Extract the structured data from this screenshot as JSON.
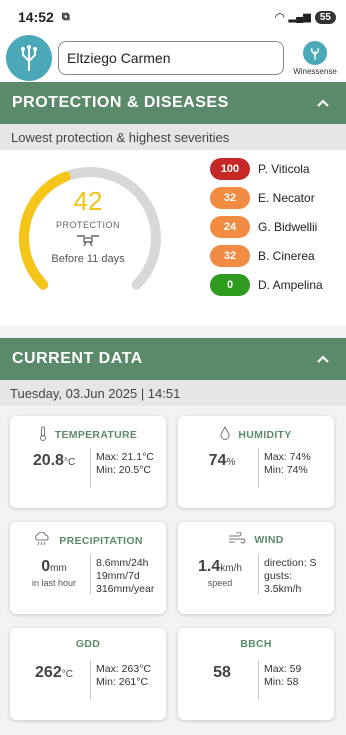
{
  "status": {
    "time": "14:52",
    "battery": "55"
  },
  "header": {
    "search_value": "Eltziego Carmen",
    "brand": "Winessense"
  },
  "protection": {
    "section_title": "PROTECTION & DISEASES",
    "subtitle": "Lowest protection & highest severities",
    "value": "42",
    "label": "PROTECTION",
    "before": "Before 11 days",
    "gauge_fraction": 0.42,
    "diseases": [
      {
        "score": "100",
        "name": "P. Viticola",
        "color": "#c62828"
      },
      {
        "score": "32",
        "name": "E. Necator",
        "color": "#f28c42"
      },
      {
        "score": "24",
        "name": "G. Bidwellii",
        "color": "#f28c42"
      },
      {
        "score": "32",
        "name": "B. Cinerea",
        "color": "#f28c42"
      },
      {
        "score": "0",
        "name": "D. Ampelina",
        "color": "#2e9a1e"
      }
    ]
  },
  "current": {
    "section_title": "CURRENT DATA",
    "date": "Tuesday, 03.Jun 2025 | 14:51",
    "temperature": {
      "title": "TEMPERATURE",
      "value": "20.8",
      "unit": "°C",
      "max": "Max: 21.1°C",
      "min": "Min: 20.5°C"
    },
    "humidity": {
      "title": "HUMIDITY",
      "value": "74",
      "unit": "%",
      "max": "Max: 74%",
      "min": "Min: 74%"
    },
    "precipitation": {
      "title": "PRECIPITATION",
      "value": "0",
      "unit": "mm",
      "sub": "in last hour",
      "line1": "8.6mm/24h",
      "line2": "19mm/7d",
      "line3": "316mm/year"
    },
    "wind": {
      "title": "WIND",
      "value": "1.4",
      "unit": "km/h",
      "sub": "speed",
      "line1": "direction: S",
      "line2": "gusts:",
      "line3": "3.5km/h"
    },
    "gdd": {
      "title": "GDD",
      "value": "262",
      "unit": "°C",
      "max": "Max: 263°C",
      "min": "Min: 261°C"
    },
    "bbch": {
      "title": "BBCH",
      "value": "58",
      "max": "Max: 59",
      "min": "Min: 58"
    }
  },
  "colors": {
    "accent_green": "#5b8a6b",
    "gauge_yellow": "#f5c518",
    "gauge_track": "#d8d8d8",
    "logo_teal": "#4aa8b8"
  }
}
